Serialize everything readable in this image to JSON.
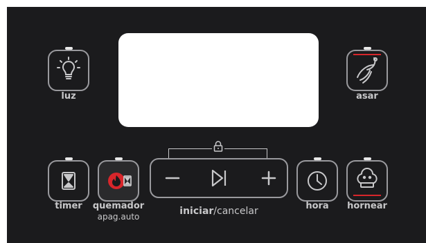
{
  "colors": {
    "panel": "#1b1b1d",
    "outline": "#9a9a9e",
    "text": "#c8c8ca",
    "accent_red": "#d8262b",
    "led": "#e8e8e8"
  },
  "display": {
    "state": "blank"
  },
  "buttons": {
    "light": {
      "label": "luz",
      "icon": "lightbulb-icon"
    },
    "broil": {
      "label": "asar",
      "icon": "broil-icon"
    },
    "timer": {
      "label": "timer",
      "icon": "hourglass-icon"
    },
    "burner": {
      "label": "quemador",
      "sublabel": "apag.auto",
      "icon": "flame-hourglass-icon"
    },
    "clock": {
      "label": "hora",
      "icon": "clock-icon"
    },
    "bake": {
      "label": "hornear",
      "icon": "chef-hat-icon"
    },
    "control": {
      "minus_icon": "minus-icon",
      "start_icon": "play-next-icon",
      "plus_icon": "plus-icon",
      "label_bold": "iniciar",
      "label_regular": "/cancelar",
      "lock_icon": "lock-icon"
    }
  }
}
